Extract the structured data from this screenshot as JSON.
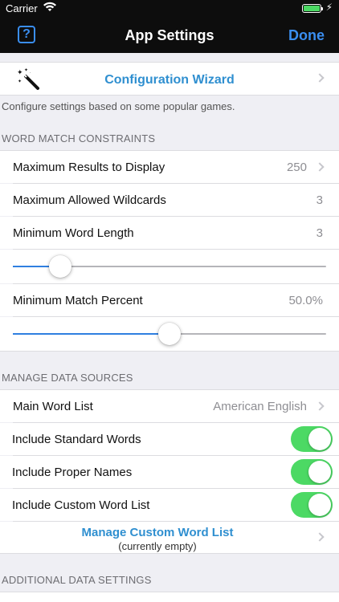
{
  "status_bar": {
    "carrier": "Carrier",
    "time": ""
  },
  "nav": {
    "help_label": "?",
    "title": "App Settings",
    "done_label": "Done"
  },
  "wizard": {
    "label": "Configuration Wizard",
    "hint": "Configure settings based on some popular games."
  },
  "word_match": {
    "header": "WORD MATCH CONSTRAINTS",
    "max_results_label": "Maximum Results to Display",
    "max_results_value": "250",
    "max_wildcards_label": "Maximum Allowed Wildcards",
    "max_wildcards_value": "3",
    "min_length_label": "Minimum Word Length",
    "min_length_value": "3",
    "min_length_slider_fraction": 0.15,
    "min_match_label": "Minimum Match Percent",
    "min_match_value": "50.0%",
    "min_match_slider_fraction": 0.5
  },
  "data_sources": {
    "header": "MANAGE DATA SOURCES",
    "main_list_label": "Main Word List",
    "main_list_value": "American English",
    "standard_words_label": "Include Standard Words",
    "standard_words_on": true,
    "proper_names_label": "Include Proper Names",
    "proper_names_on": true,
    "custom_list_label": "Include Custom Word List",
    "custom_list_on": true,
    "manage_custom_label": "Manage Custom Word List",
    "manage_custom_sub": "(currently empty)"
  },
  "additional": {
    "header": "ADDITIONAL DATA SETTINGS"
  },
  "colors": {
    "accent": "#2f8fd0",
    "toggle_on": "#4cd964",
    "nav_bg": "#0d0d0d"
  }
}
